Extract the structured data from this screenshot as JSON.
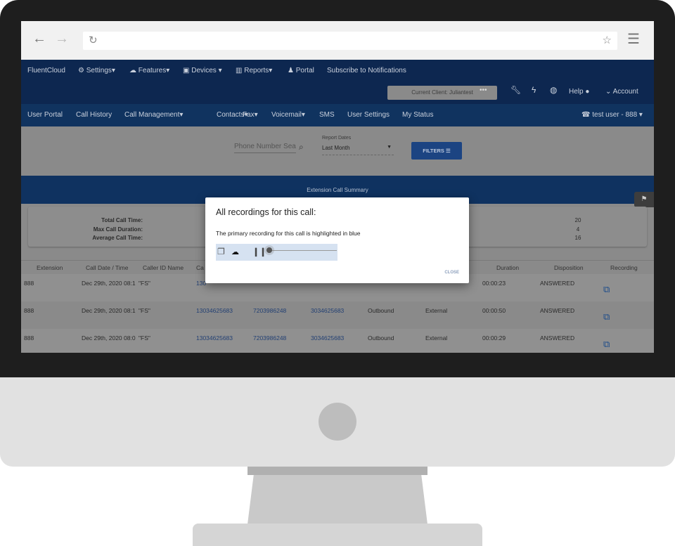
{
  "nav1": {
    "brand": "FluentCloud",
    "items": [
      "Settings",
      "Features",
      "Devices",
      "Reports",
      "Portal",
      "Subscribe to Notifications"
    ],
    "client": "Current Client: Juliantest",
    "help": "Help",
    "account": "Account"
  },
  "nav2": {
    "items": [
      "User Portal",
      "Call History",
      "Call Management",
      "Contacts",
      "Fax",
      "Voicemail",
      "SMS",
      "User Settings",
      "My Status"
    ],
    "user": "test user - 888"
  },
  "filters": {
    "search_placeholder": "Phone Number Sea",
    "report_dates_label": "Report Dates",
    "report_dates_value": "Last Month",
    "filters_button": "FILTERS"
  },
  "summary": {
    "title": "Extension Call Summary",
    "labels": [
      "Total Call Time:",
      "Max Call Duration:",
      "Average Call Time:"
    ],
    "values": [
      "20",
      "4",
      "16"
    ]
  },
  "table": {
    "headers": [
      "Extension",
      "Call Date / Time",
      "Caller ID Name",
      "Ca",
      "",
      "",
      "",
      "",
      "Duration",
      "Disposition",
      "Recording"
    ],
    "rows": [
      [
        "888",
        "Dec 29th, 2020 08:1",
        "\"FS\"",
        "130",
        "",
        "",
        "",
        "",
        "00:00:23",
        "ANSWERED"
      ],
      [
        "888",
        "Dec 29th, 2020 08:1",
        "\"FS\"",
        "13034625683",
        "7203986248",
        "3034625683",
        "Outbound",
        "External",
        "00:00:50",
        "ANSWERED"
      ],
      [
        "888",
        "Dec 29th, 2020 08:0",
        "\"FS\"",
        "13034625683",
        "7203986248",
        "3034625683",
        "Outbound",
        "External",
        "00:00:29",
        "ANSWERED"
      ]
    ]
  },
  "modal": {
    "title": "All recordings for this call:",
    "subtitle": "The primary recording for this call is highlighted in blue",
    "close": "CLOSE",
    "highlight_color": "#d6e2f1",
    "progress": 0.02
  },
  "colors": {
    "nav_dark": "#0d2750",
    "nav_secondary": "#10335f",
    "link": "#213f73"
  }
}
